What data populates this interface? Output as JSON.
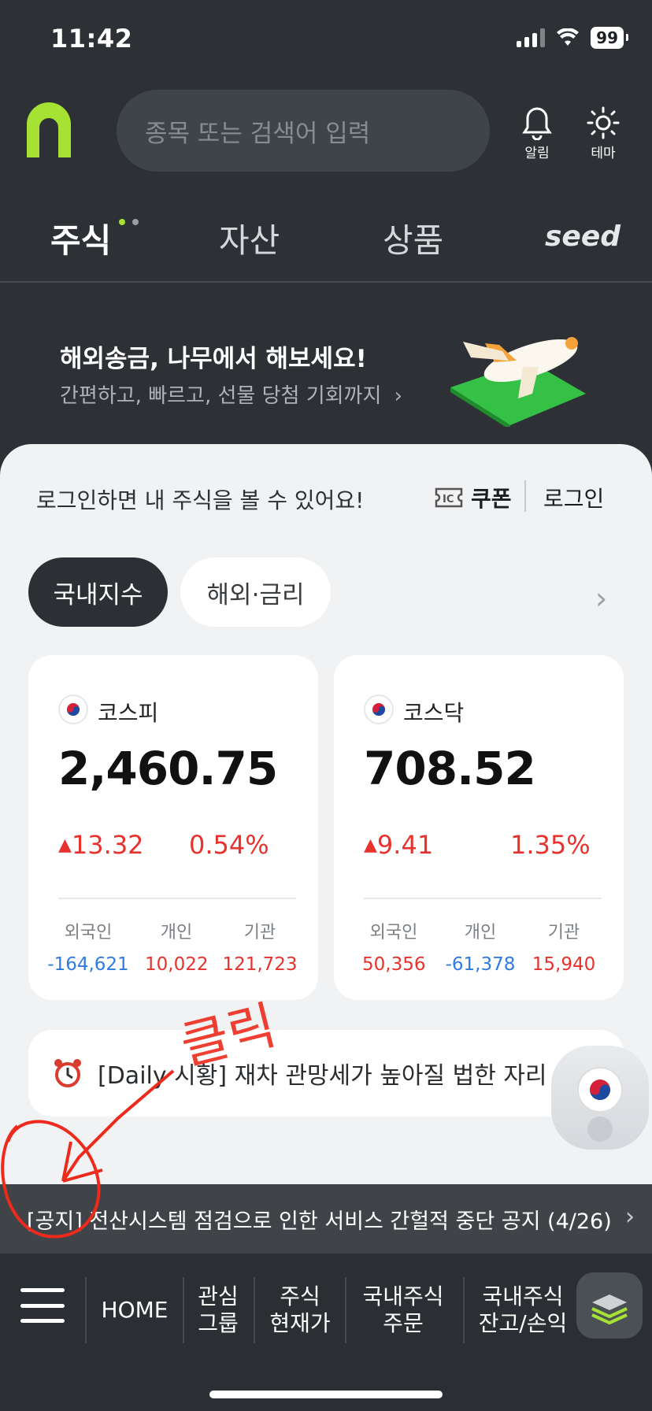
{
  "status": {
    "time": "11:42",
    "battery": "99"
  },
  "header": {
    "search_placeholder": "종목 또는 검색어 입력",
    "alarm_label": "알림",
    "theme_label": "테마"
  },
  "tabs": [
    {
      "label": "주식",
      "active": true
    },
    {
      "label": "자산",
      "active": false
    },
    {
      "label": "상품",
      "active": false
    },
    {
      "label": "seed",
      "active": false
    }
  ],
  "banner": {
    "title": "해외송금, 나무에서 해보세요!",
    "subtitle": "간편하고, 빠르고, 선물 당첨 기회까지"
  },
  "login_prompt": "로그인하면 내 주식을 볼 수 있어요!",
  "coupon_label": "쿠폰",
  "login_label": "로그인",
  "pills": {
    "domestic": "국내지수",
    "overseas": "해외·금리"
  },
  "indices": [
    {
      "name": "코스피",
      "value": "2,460.75",
      "change": "13.32",
      "percent": "0.54%",
      "investors": [
        {
          "label": "외국인",
          "value": "-164,621",
          "color": "blue"
        },
        {
          "label": "개인",
          "value": "10,022",
          "color": "red"
        },
        {
          "label": "기관",
          "value": "121,723",
          "color": "red"
        }
      ]
    },
    {
      "name": "코스닥",
      "value": "708.52",
      "change": "9.41",
      "percent": "1.35%",
      "investors": [
        {
          "label": "외국인",
          "value": "50,356",
          "color": "red"
        },
        {
          "label": "개인",
          "value": "-61,378",
          "color": "blue"
        },
        {
          "label": "기관",
          "value": "15,940",
          "color": "red"
        }
      ]
    }
  ],
  "news": {
    "text": "[Daily 시황] 재차 관망세가 높아질 법한 자리"
  },
  "notice": {
    "text": "[공지] 전산시스템 점검으로 인한 서비스 간헐적 중단 공지 (4/26)"
  },
  "annotation_text": "클릭",
  "bottom_nav": {
    "home": "HOME",
    "watch": "관심\n그룹",
    "quote": "주식\n현재가",
    "order": "국내주식\n주문",
    "balance": "국내주식\n잔고/손익"
  }
}
